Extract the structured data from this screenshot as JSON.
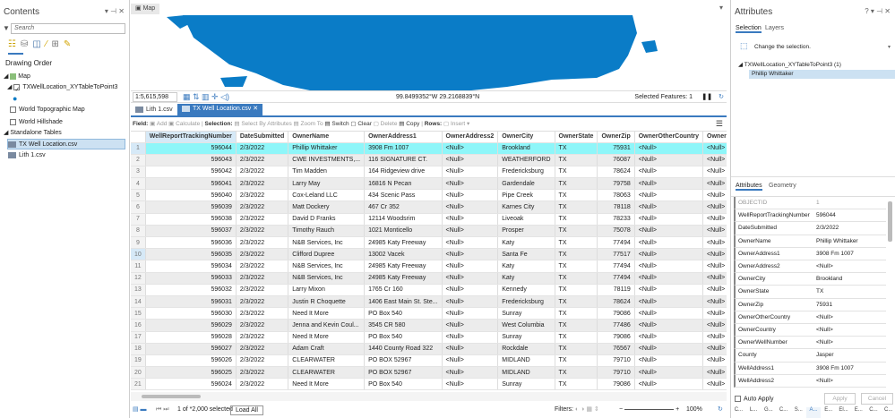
{
  "contents": {
    "title": "Contents",
    "search_placeholder": "Search",
    "drawing_order": "Drawing Order",
    "items": [
      "Map",
      "TXWellLocation_XYTableToPoint3",
      "World Topographic Map",
      "World Hillshade",
      "Standalone Tables",
      "TX Well Location.csv",
      "Lith 1.csv"
    ]
  },
  "map": {
    "tab": "Map",
    "scale": "1:5,615,598",
    "coords": "99.8499352°W 29.2168839°N",
    "selected": "Selected Features: 1",
    "color": "#0a7cc7"
  },
  "table_tabs": [
    "Lith 1.csv",
    "TX Well Location.csv"
  ],
  "toolbar": {
    "field": "Field:",
    "add": "Add",
    "calculate": "Calculate",
    "selection": "Selection:",
    "select_by_attr": "Select By Attributes",
    "zoom_to": "Zoom To",
    "switch": "Switch",
    "clear": "Clear",
    "delete": "Delete",
    "copy": "Copy",
    "rows": "Rows:",
    "insert": "Insert"
  },
  "columns": [
    "WellReportTrackingNumber",
    "DateSubmitted",
    "OwnerName",
    "OwnerAddress1",
    "OwnerAddress2",
    "OwnerCity",
    "OwnerState",
    "OwnerZip",
    "OwnerOtherCountry",
    "OwnerCoun"
  ],
  "rows": [
    [
      "596044",
      "2/3/2022",
      "Phillip Whittaker",
      "3908 Fm 1007",
      "<Null>",
      "Brookland",
      "TX",
      "75931",
      "<Null>",
      "<Null>"
    ],
    [
      "596043",
      "2/3/2022",
      "CWE INVESTMENTS,...",
      "116 SIGNATURE CT.",
      "<Null>",
      "WEATHERFORD",
      "TX",
      "76087",
      "<Null>",
      "<Null>"
    ],
    [
      "596042",
      "2/3/2022",
      "Tim Madden",
      "164 Ridgeview drive",
      "<Null>",
      "Fredericksburg",
      "TX",
      "78624",
      "<Null>",
      "<Null>"
    ],
    [
      "596041",
      "2/3/2022",
      "Larry May",
      "16816 N Pecan",
      "<Null>",
      "Gardendale",
      "TX",
      "79758",
      "<Null>",
      "<Null>"
    ],
    [
      "596040",
      "2/3/2022",
      "Cox-Leland LLC",
      "434 Scenic Pass",
      "<Null>",
      "Pipe Creek",
      "TX",
      "78063",
      "<Null>",
      "<Null>"
    ],
    [
      "596039",
      "2/3/2022",
      "Matt Dockery",
      "467 Cr 352",
      "<Null>",
      "Karnes City",
      "TX",
      "78118",
      "<Null>",
      "<Null>"
    ],
    [
      "596038",
      "2/3/2022",
      "David D Franks",
      "12114 Woodsrim",
      "<Null>",
      "Liveoak",
      "TX",
      "78233",
      "<Null>",
      "<Null>"
    ],
    [
      "596037",
      "2/3/2022",
      "Timothy Rauch",
      "1021 Monticello",
      "<Null>",
      "Prosper",
      "TX",
      "75078",
      "<Null>",
      "<Null>"
    ],
    [
      "596036",
      "2/3/2022",
      "N&B Services, Inc",
      "24985 Katy Freeway",
      "<Null>",
      "Katy",
      "TX",
      "77494",
      "<Null>",
      "<Null>"
    ],
    [
      "596035",
      "2/3/2022",
      "Clifford Dupree",
      "13002 Vacek",
      "<Null>",
      "Santa Fe",
      "TX",
      "77517",
      "<Null>",
      "<Null>"
    ],
    [
      "596034",
      "2/3/2022",
      "N&B Services, Inc",
      "24985 Katy Freeway",
      "<Null>",
      "Katy",
      "TX",
      "77494",
      "<Null>",
      "<Null>"
    ],
    [
      "596033",
      "2/3/2022",
      "N&B Services, Inc",
      "24985 Katy Freeway",
      "<Null>",
      "Katy",
      "TX",
      "77494",
      "<Null>",
      "<Null>"
    ],
    [
      "596032",
      "2/3/2022",
      "Larry Mixon",
      "1765 Cr 160",
      "<Null>",
      "Kennedy",
      "TX",
      "78119",
      "<Null>",
      "<Null>"
    ],
    [
      "596031",
      "2/3/2022",
      "Justin R Choquette",
      "1406 East Main St. Ste...",
      "<Null>",
      "Fredericksburg",
      "TX",
      "78624",
      "<Null>",
      "<Null>"
    ],
    [
      "596030",
      "2/3/2022",
      "Need It More",
      "PO Box 540",
      "<Null>",
      "Sunray",
      "TX",
      "79086",
      "<Null>",
      "<Null>"
    ],
    [
      "596029",
      "2/3/2022",
      "Jenna and Kevin Coul...",
      "3545 CR 580",
      "<Null>",
      "West Columbia",
      "TX",
      "77486",
      "<Null>",
      "<Null>"
    ],
    [
      "596028",
      "2/3/2022",
      "Need It More",
      "PO Box 540",
      "<Null>",
      "Sunray",
      "TX",
      "79086",
      "<Null>",
      "<Null>"
    ],
    [
      "596027",
      "2/3/2022",
      "Adam Craft",
      "1440 County Road 322",
      "<Null>",
      "Rockdale",
      "TX",
      "76567",
      "<Null>",
      "<Null>"
    ],
    [
      "596026",
      "2/3/2022",
      "CLEARWATER",
      "PO BOX 52967",
      "<Null>",
      "MIDLAND",
      "TX",
      "79710",
      "<Null>",
      "<Null>"
    ],
    [
      "596025",
      "2/3/2022",
      "CLEARWATER",
      "PO BOX 52967",
      "<Null>",
      "MIDLAND",
      "TX",
      "79710",
      "<Null>",
      "<Null>"
    ],
    [
      "596024",
      "2/3/2022",
      "Need It More",
      "PO Box 540",
      "<Null>",
      "Sunray",
      "TX",
      "79086",
      "<Null>",
      "<Null>"
    ]
  ],
  "footer": {
    "selected": "1 of *2,000 selected",
    "load_all": "Load All",
    "filters": "Filters:",
    "zoom": "100%"
  },
  "attributes": {
    "title": "Attributes",
    "tabs": [
      "Selection",
      "Layers"
    ],
    "change_selection": "Change the selection.",
    "layer": "TXWellLocation_XYTableToPoint3 (1)",
    "feature": "Phillip Whittaker",
    "sub_tabs": [
      "Attributes",
      "Geometry"
    ],
    "fields": [
      [
        "OBJECTID",
        "1"
      ],
      [
        "WellReportTrackingNumber",
        "596044"
      ],
      [
        "DateSubmitted",
        "2/3/2022"
      ],
      [
        "OwnerName",
        "Phillip Whittaker"
      ],
      [
        "OwnerAddress1",
        "3908 Fm 1007"
      ],
      [
        "OwnerAddress2",
        "<Null>"
      ],
      [
        "OwnerCity",
        "Brookland"
      ],
      [
        "OwnerState",
        "TX"
      ],
      [
        "OwnerZip",
        "75931"
      ],
      [
        "OwnerOtherCountry",
        "<Null>"
      ],
      [
        "OwnerCountry",
        "<Null>"
      ],
      [
        "OwnerWellNumber",
        "<Null>"
      ],
      [
        "County",
        "Jasper"
      ],
      [
        "WellAddress1",
        "3908 Fm 1007"
      ],
      [
        "WellAddress2",
        "<Null>"
      ]
    ],
    "auto_apply": "Auto Apply",
    "apply": "Apply",
    "cancel": "Cancel",
    "bottom_tabs": [
      "C...",
      "L...",
      "G...",
      "C...",
      "S...",
      "A...",
      "E...",
      "El...",
      "E...",
      "C...",
      "C..."
    ]
  }
}
